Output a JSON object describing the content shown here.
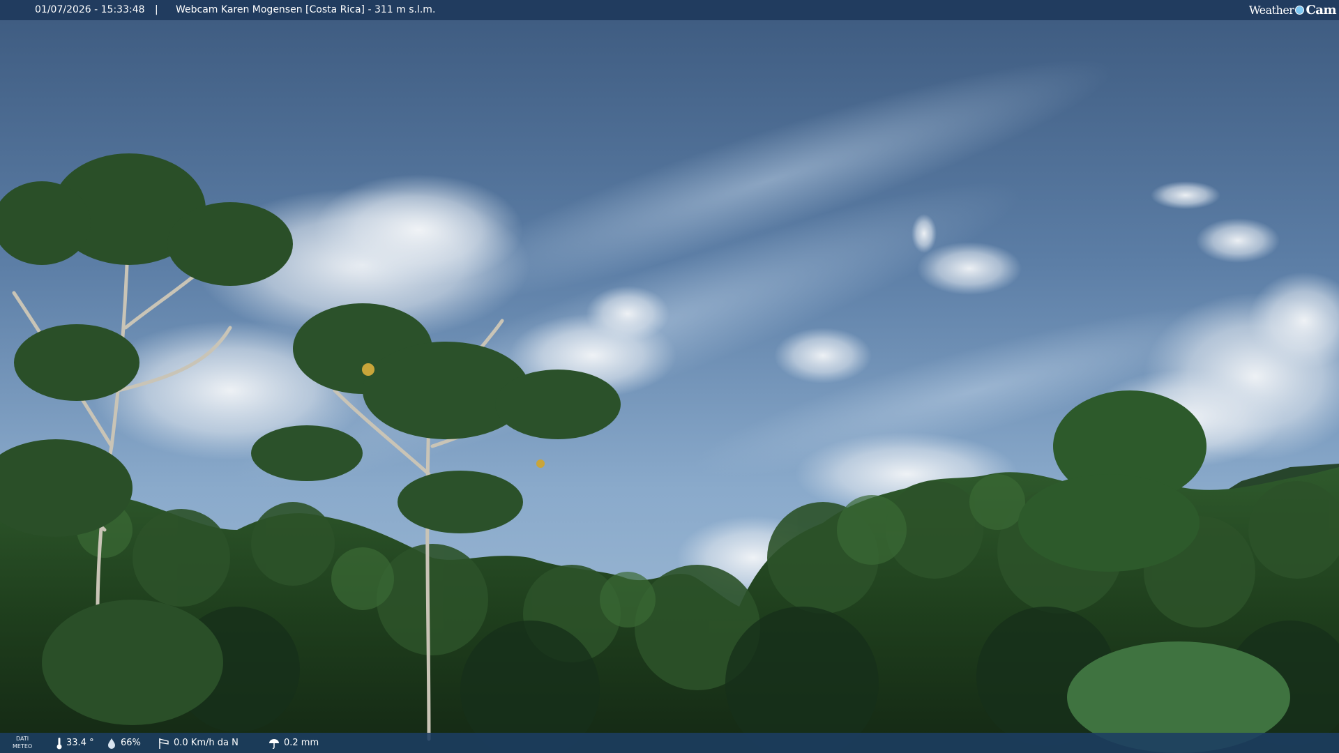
{
  "header": {
    "datetime": "01/07/2026 - 15:33:48",
    "separator": "|",
    "caption": "Webcam Karen Mogensen [Costa Rica] - 311 m s.l.m."
  },
  "logo": {
    "part1": "Weather",
    "part2": "Cam"
  },
  "meteo": {
    "label_line1": "DATI",
    "label_line2": "METEO",
    "temperature": "33.4 °",
    "humidity": "66%",
    "wind": "0.0 Km/h da N",
    "rain": "0.2 mm"
  },
  "colors": {
    "bar": "#1e3a5c",
    "sky_top": "#3e5d82",
    "sky_bottom": "#8fb0d0",
    "foliage": "#1f3d1f",
    "logo_dot": "#7fc8f2"
  },
  "icons": [
    "thermometer-icon",
    "humidity-drop-icon",
    "wind-sock-icon",
    "rain-gauge-icon"
  ]
}
